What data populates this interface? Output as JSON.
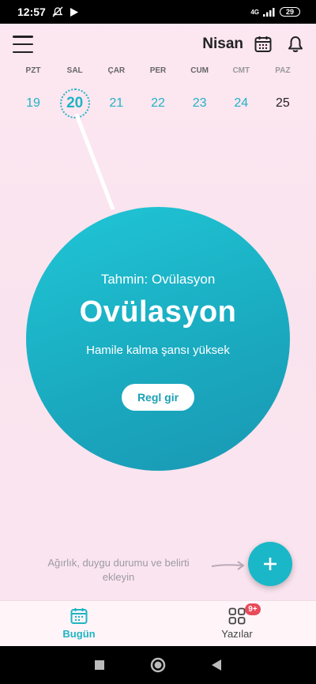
{
  "status_bar": {
    "time": "12:57",
    "network": "4G",
    "battery": "29"
  },
  "header": {
    "month": "Nisan"
  },
  "week": [
    {
      "name": "PZT",
      "num": "19"
    },
    {
      "name": "SAL",
      "num": "20"
    },
    {
      "name": "ÇAR",
      "num": "21"
    },
    {
      "name": "PER",
      "num": "22"
    },
    {
      "name": "CUM",
      "num": "23"
    },
    {
      "name": "CMT",
      "num": "24"
    },
    {
      "name": "PAZ",
      "num": "25"
    }
  ],
  "circle": {
    "prediction": "Tahmin: Ovülasyon",
    "phase": "Ovülasyon",
    "chance": "Hamile kalma şansı yüksek",
    "button": "Regl gir"
  },
  "hint": "Ağırlık, duygu durumu ve belirti ekleyin",
  "bottom_nav": {
    "today": "Bugün",
    "articles": "Yazılar",
    "badge": "9+"
  },
  "colors": {
    "accent": "#1fb4c4",
    "circle": "#1aa9bf",
    "badge": "#e84b5a"
  },
  "icons": [
    "menu-icon",
    "calendar-icon",
    "bell-icon",
    "plus-icon",
    "grid-icon"
  ]
}
